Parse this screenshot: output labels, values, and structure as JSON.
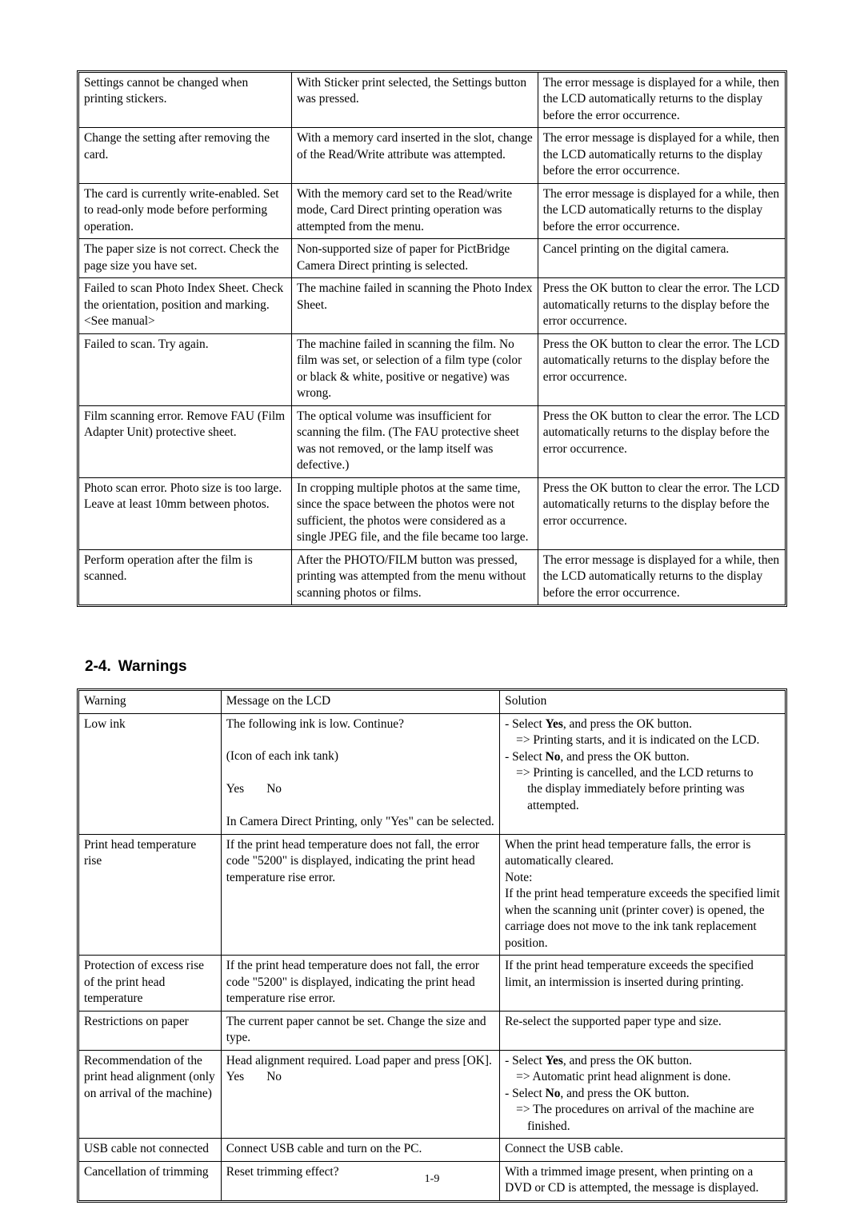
{
  "page": {
    "footer": "1-9"
  },
  "errors_table": {
    "name": "error-messages-table",
    "rows": [
      {
        "c1": "Settings cannot be changed when printing stickers.",
        "c2": "With Sticker print selected, the Settings button was pressed.",
        "c3": "The error message is displayed for a while, then the LCD automatically returns to the display before the error occurrence."
      },
      {
        "c1": "Change the setting after removing the card.",
        "c2": "With a memory card inserted in the slot, change of the Read/Write attribute was attempted.",
        "c3": "The error message is displayed for a while, then the LCD automatically returns to the display before the error occurrence."
      },
      {
        "c1": "The card is currently write-enabled. Set to read-only mode before performing operation.",
        "c2": "With the memory card set to the Read/write mode, Card Direct printing operation was attempted from the menu.",
        "c3": "The error message is displayed for a while, then the LCD automatically returns to the display before the error occurrence."
      },
      {
        "c1": "The paper size is not correct. Check the page size you have set.",
        "c2": "Non-supported size of paper for PictBridge Camera Direct printing is selected.",
        "c3": "Cancel printing on the digital camera."
      },
      {
        "c1": "Failed to scan Photo Index Sheet. Check the orientation, position and marking. <See manual>",
        "c2": "The machine failed in scanning the Photo Index Sheet.",
        "c3": "Press the OK button to clear the error. The LCD automatically returns to the display before the error occurrence."
      },
      {
        "c1": "Failed to scan. Try again.",
        "c2": "The machine failed in scanning the film. No film was set, or selection of a film type (color or black & white, positive or negative) was wrong.",
        "c3": "Press the OK button to clear the error. The LCD automatically returns to the display before the error occurrence."
      },
      {
        "c1": "Film scanning error. Remove FAU (Film Adapter Unit) protective sheet.",
        "c2": "The optical volume was insufficient for scanning the film. (The FAU protective sheet was not removed, or the lamp itself was defective.)",
        "c3": "Press the OK button to clear the error. The LCD automatically returns to the display before the error occurrence."
      },
      {
        "c1": "Photo scan error. Photo size is too large. Leave at least 10mm between photos.",
        "c2": "In cropping multiple photos at the same time, since the space between the photos were not sufficient, the photos were considered as a single JPEG file, and the file became too large.",
        "c3": "Press the OK button to clear the error. The LCD automatically returns to the display before the error occurrence."
      },
      {
        "c1": "Perform operation after the film is scanned.",
        "c2": "After the PHOTO/FILM button was pressed, printing was attempted from the menu without scanning photos or films.",
        "c3": "The error message is displayed for a while, then the LCD automatically returns to the display before the error occurrence."
      }
    ]
  },
  "section": {
    "number": "2-4.",
    "title": "Warnings"
  },
  "warnings_table": {
    "name": "warnings-table",
    "headers": {
      "c1": "Warning",
      "c2": "Message on the LCD",
      "c3": "Solution"
    },
    "rows": [
      {
        "c1": "Low ink",
        "c2_lines": [
          "The following ink is low. Continue?",
          "(Icon of each ink tank)",
          "YESNO",
          "",
          "In Camera Direct Printing, only \"Yes\" can be selected."
        ],
        "c2_yes": "Yes",
        "c2_no": "No",
        "c3_lines": [
          "- Select Yes, and press the OK button.",
          "=> Printing starts, and it is indicated on the LCD.",
          "- Select No, and press the OK button.",
          "=> Printing is cancelled, and the LCD returns to the display immediately before printing was attempted."
        ],
        "c3_seg": {
          "l1a": "- Select ",
          "l1b": "Yes",
          "l1c": ", and press the OK button.",
          "l2": "=> Printing starts, and it is indicated on the LCD.",
          "l3a": "- Select ",
          "l3b": "No",
          "l3c": ", and press the OK button.",
          "l4": "=> Printing is cancelled, and the LCD returns to",
          "l5": "the display immediately before printing was",
          "l6": "attempted."
        }
      },
      {
        "c1": "Print head temperature rise",
        "c2": "If the print head temperature does not fall, the error code \"5200\" is displayed, indicating the print head temperature rise error.",
        "c3_lines": [
          "When the print head temperature falls, the error is automatically cleared.",
          "Note:",
          "If the print head temperature exceeds the specified limit when the scanning unit (printer cover) is opened, the carriage does not move to the ink tank replacement position."
        ]
      },
      {
        "c1": "Protection of excess rise of the print head temperature",
        "c2": "If the print head temperature does not fall, the error code \"5200\" is displayed, indicating the print head temperature rise error.",
        "c3": "If the print head temperature exceeds the specified limit, an intermission is inserted during printing."
      },
      {
        "c1": "Restrictions on paper",
        "c2": "The current paper cannot be set. Change the size and type.",
        "c3": "Re-select the supported paper type and size."
      },
      {
        "c1": "Recommendation of the print head alignment (only on arrival of the machine)",
        "c2_lines": [
          "Head alignment required. Load paper and press [OK].",
          "YESNO"
        ],
        "c2_yes": "Yes",
        "c2_no": "No",
        "c3_seg": {
          "l1a": "- Select ",
          "l1b": "Yes",
          "l1c": ", and press the OK button.",
          "l2": "=> Automatic print head alignment is done.",
          "l3a": "- Select ",
          "l3b": "No",
          "l3c": ", and press the OK button.",
          "l4": "=> The procedures on arrival of the machine are",
          "l5": "finished."
        }
      },
      {
        "c1": "USB cable not connected",
        "c2": "Connect USB cable and turn on the PC.",
        "c3": "Connect the USB cable."
      },
      {
        "c1": "Cancellation of trimming",
        "c2": "Reset trimming effect?",
        "c3": "With a trimmed image present, when printing on a DVD or CD is attempted, the message is displayed."
      }
    ]
  }
}
